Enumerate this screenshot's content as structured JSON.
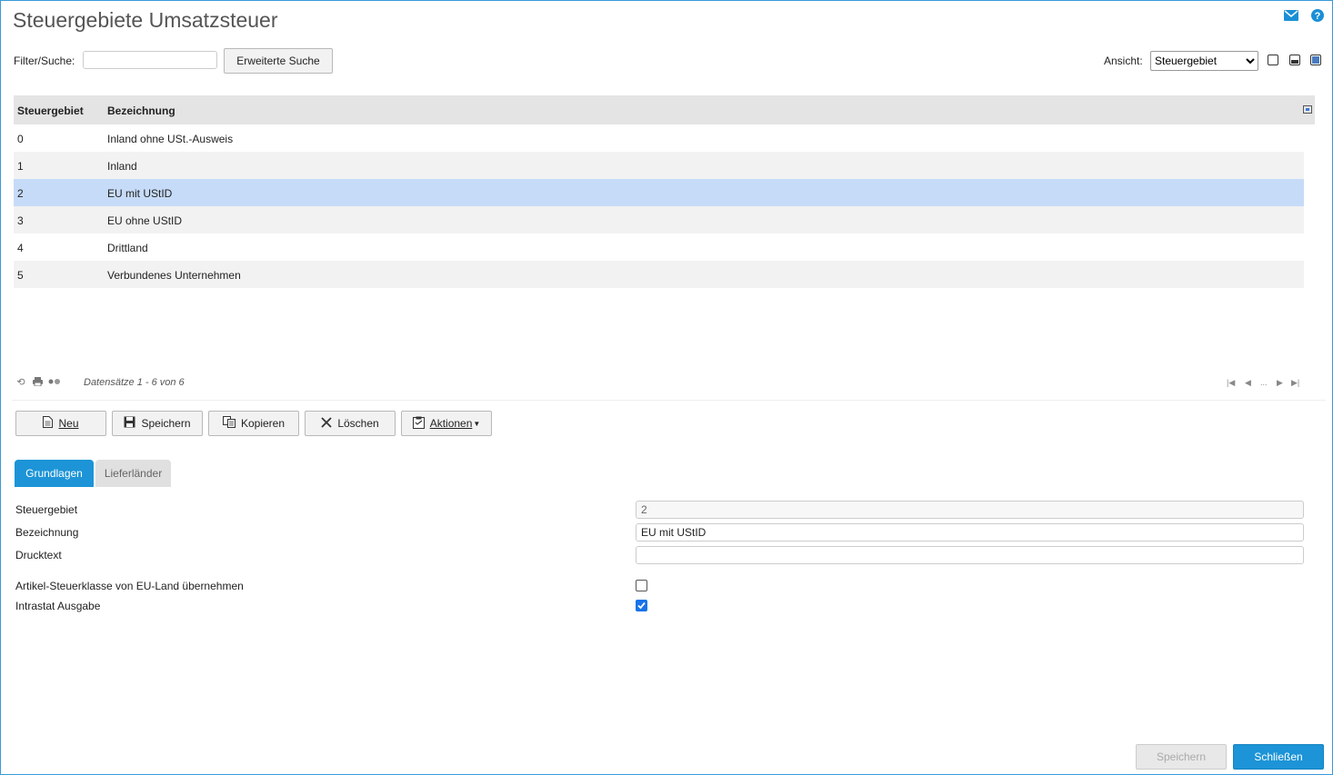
{
  "header": {
    "title": "Steuergebiete Umsatzsteuer",
    "mail_icon": "mail-icon",
    "help_icon": "help-icon"
  },
  "toolbar": {
    "filter_label": "Filter/Suche:",
    "filter_value": "",
    "advanced_search_label": "Erweiterte Suche",
    "view_label": "Ansicht:",
    "view_selected": "Steuergebiet"
  },
  "grid": {
    "columns": [
      "Steuergebiet",
      "Bezeichnung"
    ],
    "rows": [
      {
        "code": "0",
        "name": "Inland ohne USt.-Ausweis"
      },
      {
        "code": "1",
        "name": "Inland"
      },
      {
        "code": "2",
        "name": "EU mit UStID"
      },
      {
        "code": "3",
        "name": "EU ohne UStID"
      },
      {
        "code": "4",
        "name": "Drittland"
      },
      {
        "code": "5",
        "name": "Verbundenes Unternehmen"
      }
    ],
    "selected_index": 2,
    "record_count": "Datensätze 1 - 6 von 6",
    "pager_ellipsis": "..."
  },
  "actions": {
    "new_label": "Neu",
    "save_label": "Speichern",
    "copy_label": "Kopieren",
    "delete_label": "Löschen",
    "actions_label": "Aktionen"
  },
  "tabs": [
    {
      "label": "Grundlagen",
      "active": true
    },
    {
      "label": "Lieferländer",
      "active": false
    }
  ],
  "form": {
    "steuergebiet_label": "Steuergebiet",
    "steuergebiet_value": "2",
    "bezeichnung_label": "Bezeichnung",
    "bezeichnung_value": "EU mit UStID",
    "drucktext_label": "Drucktext",
    "drucktext_value": "",
    "artikel_label": "Artikel-Steuerklasse von EU-Land übernehmen",
    "artikel_checked": false,
    "intrastat_label": "Intrastat Ausgabe",
    "intrastat_checked": true
  },
  "footer": {
    "save_label": "Speichern",
    "close_label": "Schließen"
  },
  "colors": {
    "accent": "#1c94d7",
    "selected_row": "#c6dbf7",
    "header_bg": "#e4e4e4"
  }
}
